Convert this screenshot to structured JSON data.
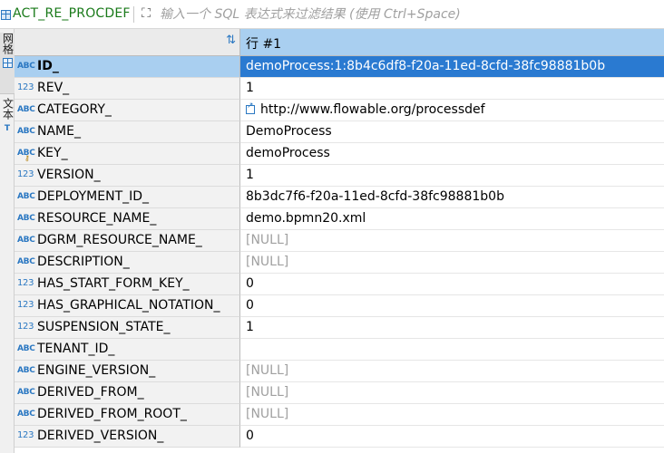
{
  "filter": {
    "table_name": "ACT_RE_PROCDEF",
    "placeholder": "输入一个 SQL 表达式来过滤结果 (使用 Ctrl+Space)"
  },
  "side_tabs": {
    "grid_label": "网格",
    "text_label": "文本",
    "text_icon": "T"
  },
  "header": {
    "row_label": "行 #1"
  },
  "rows": [
    {
      "type": "abc",
      "name": "ID_",
      "value": "demoProcess:1:8b4c6df8-f20a-11ed-8cfd-38fc98881b0b",
      "selected": true
    },
    {
      "type": "123",
      "name": "REV_",
      "value": "1"
    },
    {
      "type": "abc",
      "name": "CATEGORY_",
      "value": "http://www.flowable.org/processdef",
      "link": true
    },
    {
      "type": "abc",
      "name": "NAME_",
      "value": "DemoProcess"
    },
    {
      "type": "abc-key",
      "name": "KEY_",
      "value": "demoProcess"
    },
    {
      "type": "123",
      "name": "VERSION_",
      "value": "1"
    },
    {
      "type": "abc",
      "name": "DEPLOYMENT_ID_",
      "value": "8b3dc7f6-f20a-11ed-8cfd-38fc98881b0b"
    },
    {
      "type": "abc",
      "name": "RESOURCE_NAME_",
      "value": "demo.bpmn20.xml"
    },
    {
      "type": "abc",
      "name": "DGRM_RESOURCE_NAME_",
      "value": "[NULL]",
      "null": true
    },
    {
      "type": "abc",
      "name": "DESCRIPTION_",
      "value": "[NULL]",
      "null": true
    },
    {
      "type": "123",
      "name": "HAS_START_FORM_KEY_",
      "value": "0"
    },
    {
      "type": "123",
      "name": "HAS_GRAPHICAL_NOTATION_",
      "value": "0"
    },
    {
      "type": "123",
      "name": "SUSPENSION_STATE_",
      "value": "1"
    },
    {
      "type": "abc",
      "name": "TENANT_ID_",
      "value": ""
    },
    {
      "type": "abc",
      "name": "ENGINE_VERSION_",
      "value": "[NULL]",
      "null": true
    },
    {
      "type": "abc",
      "name": "DERIVED_FROM_",
      "value": "[NULL]",
      "null": true
    },
    {
      "type": "abc",
      "name": "DERIVED_FROM_ROOT_",
      "value": "[NULL]",
      "null": true
    },
    {
      "type": "123",
      "name": "DERIVED_VERSION_",
      "value": "0"
    }
  ],
  "icons": {
    "table": "table-icon",
    "expand": "expand-icon",
    "sort": "sort-icon",
    "string_type": "abc-type-icon",
    "number_type": "123-type-icon",
    "key_type": "key-column-icon",
    "link": "link-icon"
  },
  "colors": {
    "header_selected": "#a9cff0",
    "row_selected": "#2a7ad1",
    "table_name": "#1a7a1a",
    "null_text": "#a0a0a0"
  }
}
